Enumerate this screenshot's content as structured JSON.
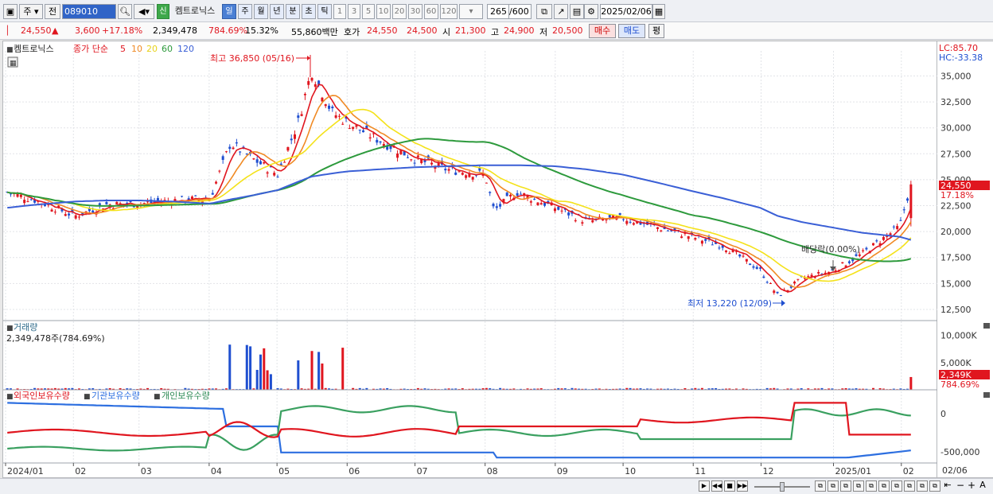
{
  "toolbar": {
    "market": "주",
    "prev": "전",
    "code": "089010",
    "badge": "신",
    "name": "켐트로닉스",
    "periods": [
      "일",
      "주",
      "월",
      "년",
      "분",
      "초",
      "틱"
    ],
    "minutes": [
      "1",
      "3",
      "5",
      "10",
      "20",
      "30",
      "60",
      "120"
    ],
    "count": "265",
    "total": "/600",
    "date": "2025/02/06"
  },
  "quote": {
    "price": "24,550",
    "change": "3,600",
    "change_pct": "+17.18%",
    "volume": "2,349,478",
    "vol_ratio": "784.69%",
    "turnover": "15.32%",
    "amount": "55,860백만",
    "bid_label": "호가",
    "ask": "24,550",
    "bid": "24,500",
    "open_label": "시",
    "open": "21,300",
    "high_label": "고",
    "high": "24,900",
    "low_label": "저",
    "low": "20,500",
    "buy_btn": "매수",
    "sell_btn": "매도",
    "eval_btn": "평"
  },
  "legend": {
    "name": "켐트로닉스",
    "ma_title": "종가 단순",
    "ma_periods": [
      "5",
      "10",
      "20",
      "60",
      "120"
    ],
    "volume_title": "거래량",
    "volume_value": "2,349,478주(784.69%)",
    "holdings": [
      "외국인보유수량",
      "기관보유수량",
      "개인보유수량"
    ]
  },
  "annotations": {
    "high": "최고 36,850 (05/16)",
    "low": "최저 13,220 (12/09)",
    "ex_div": "배당락(0.00%)",
    "lc": "LC:85.70",
    "hc": "HC:-33.38",
    "last_price": "24,550",
    "last_pct": "17.18%",
    "last_vol": "2,349K",
    "last_vol_pct": "784.69%"
  },
  "colors": {
    "up": "#e0161f",
    "down": "#1f4fd0",
    "ma5": "#e0161f",
    "ma10": "#f08a24",
    "ma20": "#f4e21a",
    "ma60": "#2d9a3c",
    "ma120": "#3a5fd6",
    "foreign": "#e0161f",
    "institution": "#2d6fe0",
    "individual": "#3aa060"
  },
  "chart_data": {
    "type": "line",
    "title": "켐트로닉스",
    "x": [
      "2024-01-02",
      "2024-01-15",
      "2024-02-01",
      "2024-02-15",
      "2024-03-01",
      "2024-03-15",
      "2024-04-01",
      "2024-04-10",
      "2024-04-20",
      "2024-05-01",
      "2024-05-10",
      "2024-05-16",
      "2024-05-25",
      "2024-06-01",
      "2024-06-15",
      "2024-07-01",
      "2024-07-15",
      "2024-08-01",
      "2024-08-05",
      "2024-08-15",
      "2024-09-01",
      "2024-09-15",
      "2024-10-01",
      "2024-10-15",
      "2024-11-01",
      "2024-11-15",
      "2024-12-01",
      "2024-12-09",
      "2024-12-20",
      "2025-01-02",
      "2025-01-15",
      "2025-02-01",
      "2025-02-06"
    ],
    "series": [
      {
        "name": "종가",
        "values": [
          23800,
          23000,
          21500,
          22600,
          22700,
          23000,
          23200,
          28500,
          27000,
          25500,
          30500,
          35500,
          31500,
          30500,
          28800,
          27000,
          26000,
          25500,
          22000,
          23800,
          22300,
          21000,
          21300,
          20500,
          19500,
          18600,
          16300,
          13800,
          15500,
          16200,
          17800,
          20500,
          24550
        ]
      },
      {
        "name": "120",
        "values": [
          22300,
          22600,
          22900,
          23000,
          23000,
          22900,
          22700,
          23100,
          23500,
          24000,
          24800,
          25300,
          25600,
          25800,
          26000,
          26200,
          26300,
          26400,
          26400,
          26400,
          26300,
          26000,
          25500,
          24800,
          23900,
          23200,
          22300,
          21500,
          20900,
          20400,
          19900,
          19500,
          19200
        ]
      }
    ],
    "ylabel": "",
    "ylim": [
      11500,
      36800
    ],
    "y_ticks": [
      "35,000",
      "32,500",
      "30,000",
      "27,500",
      "25,000",
      "22,500",
      "20,000",
      "17,500",
      "15,000",
      "12,500"
    ],
    "x_ticks": [
      "2024/01",
      "02",
      "03",
      "04",
      "05",
      "06",
      "07",
      "08",
      "09",
      "10",
      "11",
      "12",
      "2025/01",
      "02",
      "02/06"
    ],
    "volume_ticks": [
      "10,000K",
      "5,000K"
    ],
    "holding_ticks": [
      "0",
      "-500,000"
    ],
    "grid": true
  }
}
